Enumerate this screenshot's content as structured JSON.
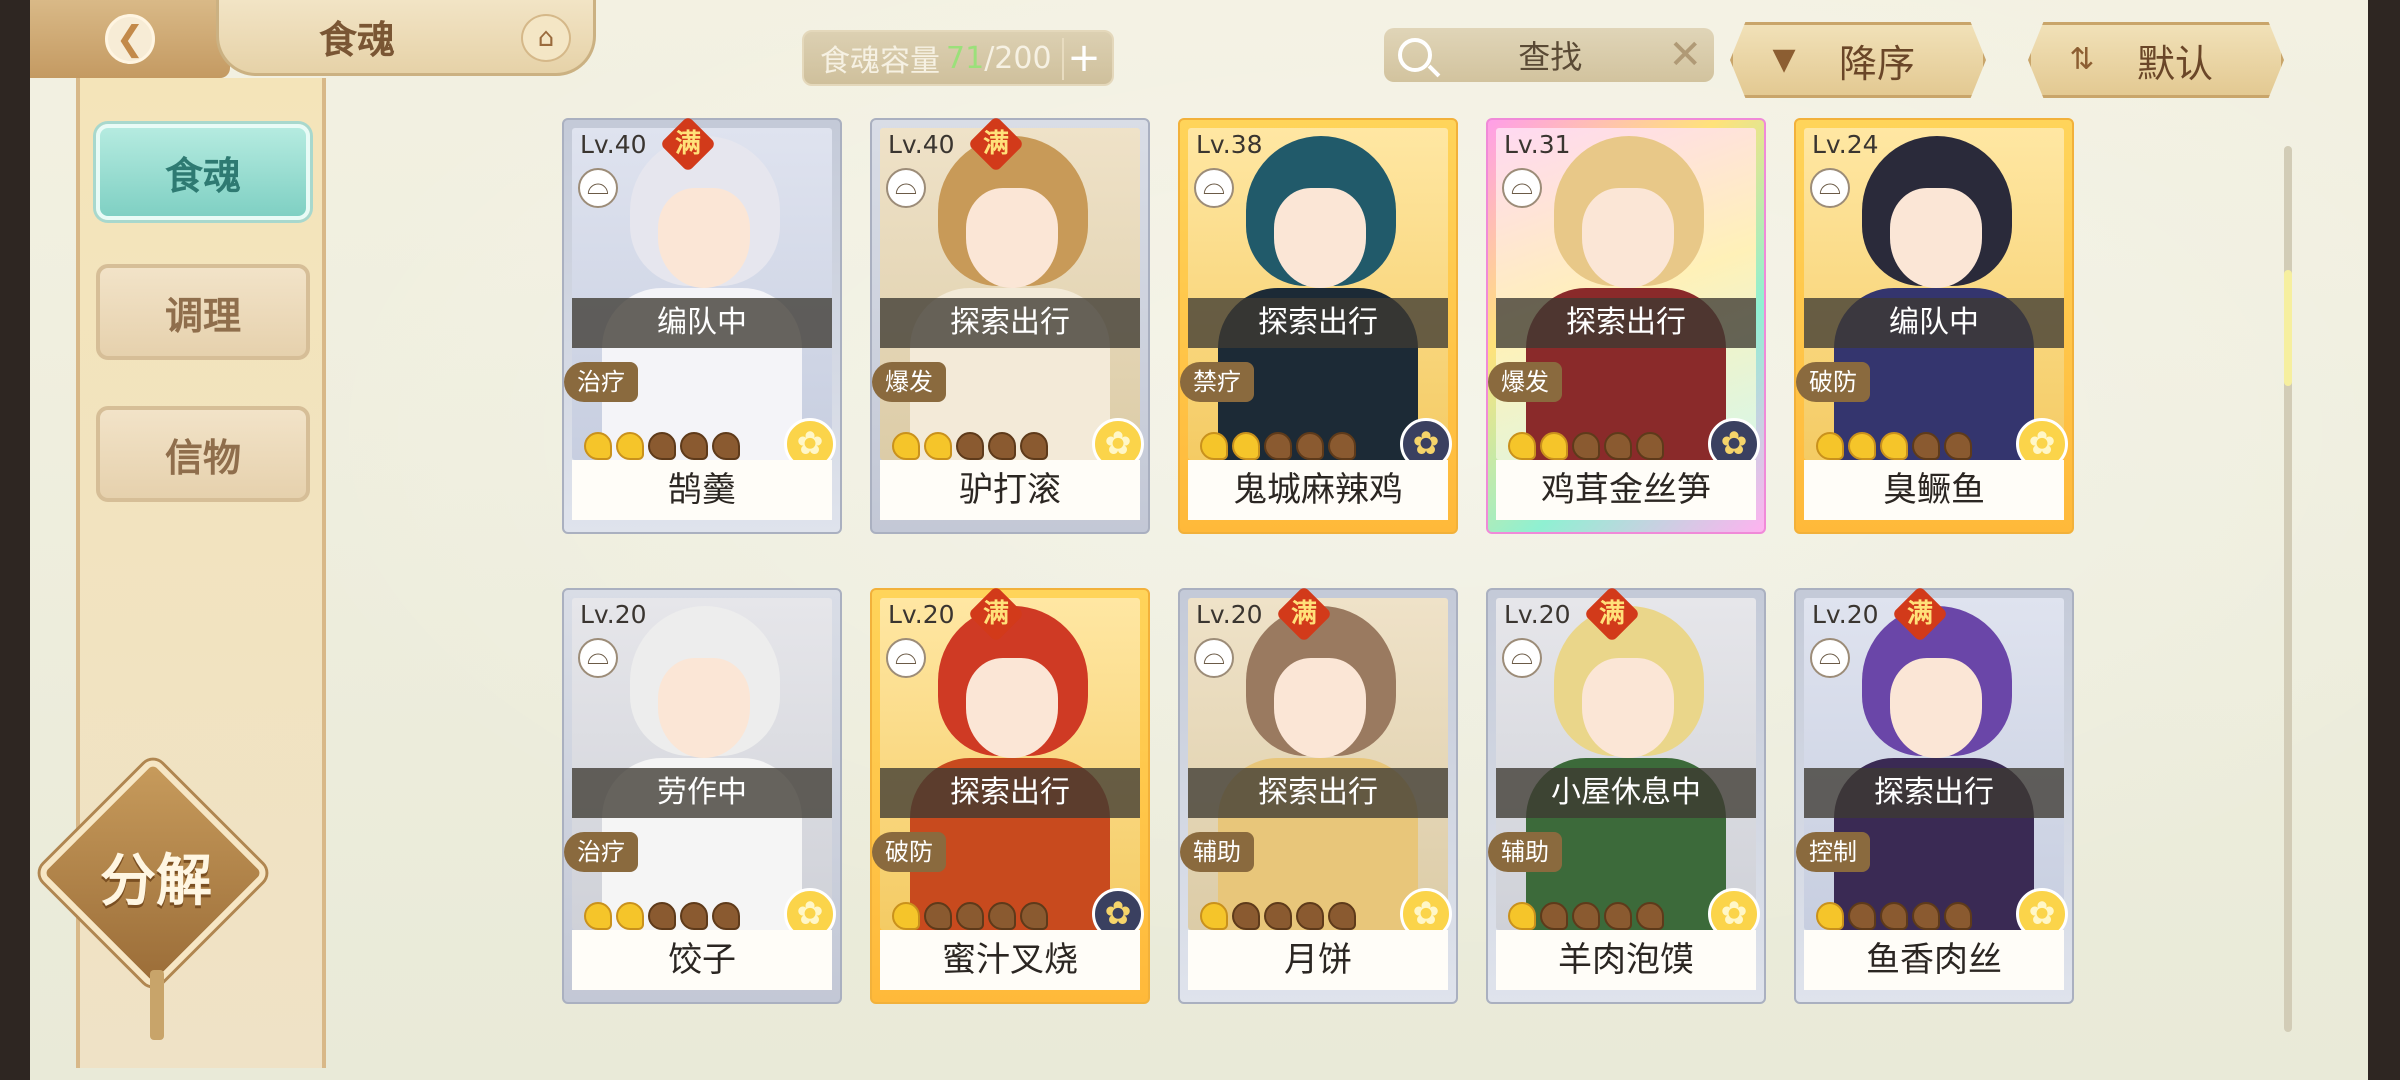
{
  "header": {
    "title": "食魂",
    "capacity_label": "食魂容量",
    "capacity_current": "71",
    "capacity_separator": "/",
    "capacity_max": "200",
    "search_placeholder": "查找",
    "sort_order_label": "降序",
    "sort_default_label": "默认"
  },
  "sidebar": {
    "tabs": [
      {
        "label": "食魂"
      },
      {
        "label": "调理"
      },
      {
        "label": "信物"
      }
    ],
    "decompose_label": "分解"
  },
  "cards": [
    {
      "level": "Lv.40",
      "full": "满",
      "status": "编队中",
      "role": "治疗",
      "stars": 5,
      "lit": 2,
      "name": "鹄羹",
      "elem": "gold"
    },
    {
      "level": "Lv.40",
      "full": "满",
      "status": "探索出行",
      "role": "爆发",
      "stars": 5,
      "lit": 2,
      "name": "驴打滚",
      "elem": "gold"
    },
    {
      "level": "Lv.38",
      "full": "",
      "status": "探索出行",
      "role": "禁疗",
      "stars": 5,
      "lit": 2,
      "name": "鬼城麻辣鸡",
      "elem": "dark"
    },
    {
      "level": "Lv.31",
      "full": "",
      "status": "探索出行",
      "role": "爆发",
      "stars": 5,
      "lit": 2,
      "name": "鸡茸金丝笋",
      "elem": "dark"
    },
    {
      "level": "Lv.24",
      "full": "",
      "status": "编队中",
      "role": "破防",
      "stars": 5,
      "lit": 3,
      "name": "臭鳜鱼",
      "elem": "gold"
    },
    {
      "level": "Lv.20",
      "full": "",
      "status": "劳作中",
      "role": "治疗",
      "stars": 5,
      "lit": 2,
      "name": "饺子",
      "elem": "gold"
    },
    {
      "level": "Lv.20",
      "full": "满",
      "status": "探索出行",
      "role": "破防",
      "stars": 5,
      "lit": 1,
      "name": "蜜汁叉烧",
      "elem": "dark"
    },
    {
      "level": "Lv.20",
      "full": "满",
      "status": "探索出行",
      "role": "辅助",
      "stars": 5,
      "lit": 1,
      "name": "月饼",
      "elem": "gold"
    },
    {
      "level": "Lv.20",
      "full": "满",
      "status": "小屋休息中",
      "role": "辅助",
      "stars": 5,
      "lit": 1,
      "name": "羊肉泡馍",
      "elem": "gold"
    },
    {
      "level": "Lv.20",
      "full": "满",
      "status": "探索出行",
      "role": "控制",
      "stars": 5,
      "lit": 1,
      "name": "鱼香肉丝",
      "elem": "gold"
    }
  ]
}
